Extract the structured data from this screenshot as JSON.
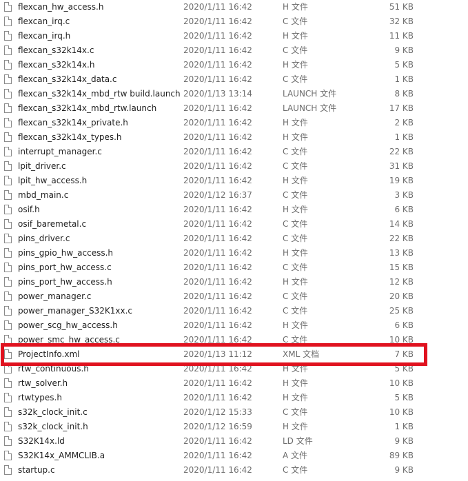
{
  "files": [
    {
      "name": "flexcan_hw_access.h",
      "date": "2020/1/11 16:42",
      "type": "H 文件",
      "size": "51 KB"
    },
    {
      "name": "flexcan_irq.c",
      "date": "2020/1/11 16:42",
      "type": "C 文件",
      "size": "32 KB"
    },
    {
      "name": "flexcan_irq.h",
      "date": "2020/1/11 16:42",
      "type": "H 文件",
      "size": "11 KB"
    },
    {
      "name": "flexcan_s32k14x.c",
      "date": "2020/1/11 16:42",
      "type": "C 文件",
      "size": "9 KB"
    },
    {
      "name": "flexcan_s32k14x.h",
      "date": "2020/1/11 16:42",
      "type": "H 文件",
      "size": "5 KB"
    },
    {
      "name": "flexcan_s32k14x_data.c",
      "date": "2020/1/11 16:42",
      "type": "C 文件",
      "size": "1 KB"
    },
    {
      "name": "flexcan_s32k14x_mbd_rtw build.launch",
      "date": "2020/1/13 13:14",
      "type": "LAUNCH 文件",
      "size": "8 KB"
    },
    {
      "name": "flexcan_s32k14x_mbd_rtw.launch",
      "date": "2020/1/11 16:42",
      "type": "LAUNCH 文件",
      "size": "17 KB"
    },
    {
      "name": "flexcan_s32k14x_private.h",
      "date": "2020/1/11 16:42",
      "type": "H 文件",
      "size": "2 KB"
    },
    {
      "name": "flexcan_s32k14x_types.h",
      "date": "2020/1/11 16:42",
      "type": "H 文件",
      "size": "1 KB"
    },
    {
      "name": "interrupt_manager.c",
      "date": "2020/1/11 16:42",
      "type": "C 文件",
      "size": "22 KB"
    },
    {
      "name": "lpit_driver.c",
      "date": "2020/1/11 16:42",
      "type": "C 文件",
      "size": "31 KB"
    },
    {
      "name": "lpit_hw_access.h",
      "date": "2020/1/11 16:42",
      "type": "H 文件",
      "size": "19 KB"
    },
    {
      "name": "mbd_main.c",
      "date": "2020/1/12 16:37",
      "type": "C 文件",
      "size": "3 KB"
    },
    {
      "name": "osif.h",
      "date": "2020/1/11 16:42",
      "type": "H 文件",
      "size": "6 KB"
    },
    {
      "name": "osif_baremetal.c",
      "date": "2020/1/11 16:42",
      "type": "C 文件",
      "size": "14 KB"
    },
    {
      "name": "pins_driver.c",
      "date": "2020/1/11 16:42",
      "type": "C 文件",
      "size": "22 KB"
    },
    {
      "name": "pins_gpio_hw_access.h",
      "date": "2020/1/11 16:42",
      "type": "H 文件",
      "size": "13 KB"
    },
    {
      "name": "pins_port_hw_access.c",
      "date": "2020/1/11 16:42",
      "type": "C 文件",
      "size": "15 KB"
    },
    {
      "name": "pins_port_hw_access.h",
      "date": "2020/1/11 16:42",
      "type": "H 文件",
      "size": "12 KB"
    },
    {
      "name": "power_manager.c",
      "date": "2020/1/11 16:42",
      "type": "C 文件",
      "size": "20 KB"
    },
    {
      "name": "power_manager_S32K1xx.c",
      "date": "2020/1/11 16:42",
      "type": "C 文件",
      "size": "25 KB"
    },
    {
      "name": "power_scg_hw_access.h",
      "date": "2020/1/11 16:42",
      "type": "H 文件",
      "size": "6 KB"
    },
    {
      "name": "power_smc_hw_access.c",
      "date": "2020/1/11 16:42",
      "type": "C 文件",
      "size": "10 KB"
    },
    {
      "name": "ProjectInfo.xml",
      "date": "2020/1/13 11:12",
      "type": "XML 文档",
      "size": "7 KB"
    },
    {
      "name": "rtw_continuous.h",
      "date": "2020/1/11 16:42",
      "type": "H 文件",
      "size": "5 KB"
    },
    {
      "name": "rtw_solver.h",
      "date": "2020/1/11 16:42",
      "type": "H 文件",
      "size": "10 KB"
    },
    {
      "name": "rtwtypes.h",
      "date": "2020/1/11 16:42",
      "type": "H 文件",
      "size": "5 KB"
    },
    {
      "name": "s32k_clock_init.c",
      "date": "2020/1/12 15:33",
      "type": "C 文件",
      "size": "10 KB"
    },
    {
      "name": "s32k_clock_init.h",
      "date": "2020/1/12 16:59",
      "type": "H 文件",
      "size": "1 KB"
    },
    {
      "name": "S32K14x.ld",
      "date": "2020/1/11 16:42",
      "type": "LD 文件",
      "size": "9 KB"
    },
    {
      "name": "S32K14x_AMMCLIB.a",
      "date": "2020/1/11 16:42",
      "type": "A 文件",
      "size": "89 KB"
    },
    {
      "name": "startup.c",
      "date": "2020/1/11 16:42",
      "type": "C 文件",
      "size": "9 KB"
    }
  ],
  "highlight_color": "#e0121f"
}
